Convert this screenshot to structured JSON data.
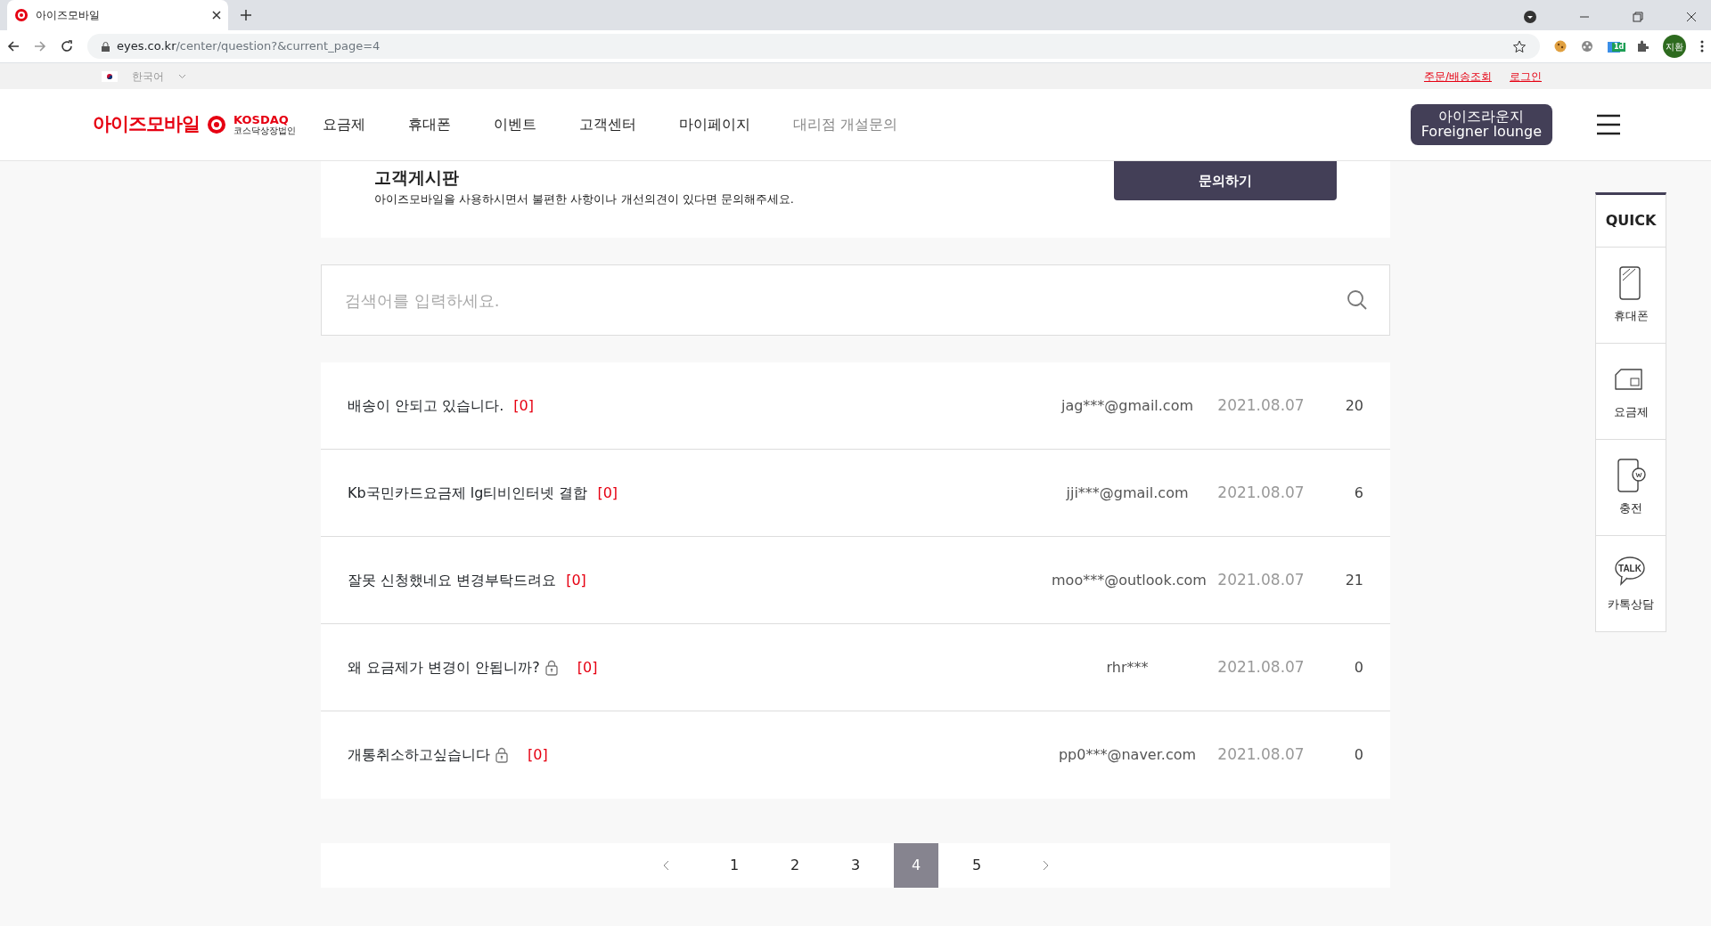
{
  "browser": {
    "tab_title": "아이즈모바일",
    "url_host": "eyes.co.kr",
    "url_path": "/center/question?&current_page=4",
    "extension_badge": "1d",
    "profile": "지환"
  },
  "topbar": {
    "language": "한국어",
    "links": [
      "주문/배송조회",
      "로그인"
    ]
  },
  "header": {
    "logo": "아이즈모바일",
    "logo_sub_top": "KOSDAQ",
    "logo_sub_bottom": "코스닥상장법인",
    "nav": [
      {
        "label": "요금제",
        "muted": false
      },
      {
        "label": "휴대폰",
        "muted": false
      },
      {
        "label": "이벤트",
        "muted": false
      },
      {
        "label": "고객센터",
        "muted": false
      },
      {
        "label": "마이페이지",
        "muted": false
      },
      {
        "label": "대리점 개설문의",
        "muted": true
      }
    ],
    "lounge_button": [
      "아이즈라운지",
      "Foreigner lounge"
    ]
  },
  "board": {
    "title": "고객게시판",
    "description": "아이즈모바일을 사용하시면서 불편한 사항이나 개선의견이 있다면 문의해주세요.",
    "ask_button": "문의하기"
  },
  "search": {
    "placeholder": "검색어를 입력하세요."
  },
  "posts": [
    {
      "title": "배송이 안되고 있습니다.",
      "locked": false,
      "comments": "[0]",
      "author": "jag***@gmail.com",
      "date": "2021.08.07",
      "views": "20"
    },
    {
      "title": "Kb국민카드요금제 lg티비인터넷 결합",
      "locked": false,
      "comments": "[0]",
      "author": "jji***@gmail.com",
      "date": "2021.08.07",
      "views": "6"
    },
    {
      "title": "잘못 신청했네요 변경부탁드려요",
      "locked": false,
      "comments": "[0]",
      "author": "moo***@outlook.com",
      "date": "2021.08.07",
      "views": "21"
    },
    {
      "title": "왜 요금제가 변경이 안됩니까?",
      "locked": true,
      "comments": "[0]",
      "author": "rhr***",
      "date": "2021.08.07",
      "views": "0"
    },
    {
      "title": "개통취소하고싶습니다",
      "locked": true,
      "comments": "[0]",
      "author": "pp0***@naver.com",
      "date": "2021.08.07",
      "views": "0"
    }
  ],
  "pagination": [
    {
      "label": "1",
      "selected": false
    },
    {
      "label": "2",
      "selected": false
    },
    {
      "label": "3",
      "selected": false
    },
    {
      "label": "4",
      "selected": true
    },
    {
      "label": "5",
      "selected": false
    }
  ],
  "quick": {
    "title": "QUICK",
    "items": [
      {
        "kind": "phone",
        "label": "휴대폰"
      },
      {
        "kind": "sim",
        "label": "요금제"
      },
      {
        "kind": "charge",
        "label": "충전"
      },
      {
        "kind": "talk",
        "label": "카톡상담",
        "icon_text": "TALK"
      }
    ]
  }
}
